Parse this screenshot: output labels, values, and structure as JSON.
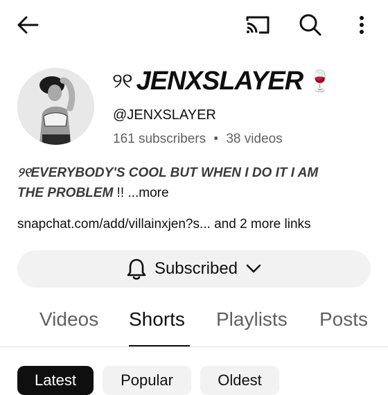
{
  "topbar": {
    "back_icon": "arrow-left-icon",
    "cast_icon": "cast-icon",
    "search_icon": "search-icon",
    "more_icon": "more-vertical-icon"
  },
  "channel": {
    "title_prefix": "୨୧",
    "title": "JENXSLAYER",
    "title_emoji": "🍷",
    "handle": "@JENXSLAYER",
    "subscribers": "161 subscribers",
    "separator": "•",
    "videos": "38 videos",
    "description_line1": "୨୧EVERYBODY'S COOL BUT WHEN I DO IT I AM",
    "description_line2": "THE PROBLEM",
    "description_suffix": " !! ",
    "more_label": "...more",
    "link_text": "snapchat.com/add/villainxjen?s...",
    "more_links": " and 2 more links"
  },
  "subscribe_button": {
    "label": "Subscribed",
    "bell_icon": "bell-icon",
    "chevron_icon": "chevron-down-icon"
  },
  "tabs": [
    {
      "label": "Videos",
      "active": false
    },
    {
      "label": "Shorts",
      "active": true
    },
    {
      "label": "Playlists",
      "active": false
    },
    {
      "label": "Posts",
      "active": false
    }
  ],
  "chips": [
    {
      "label": "Latest",
      "selected": true
    },
    {
      "label": "Popular",
      "selected": false
    },
    {
      "label": "Oldest",
      "selected": false
    }
  ],
  "colors": {
    "text_primary": "#0f0f0f",
    "text_secondary": "#606060",
    "chip_bg": "#f2f2f2",
    "chip_selected_bg": "#0f0f0f"
  }
}
